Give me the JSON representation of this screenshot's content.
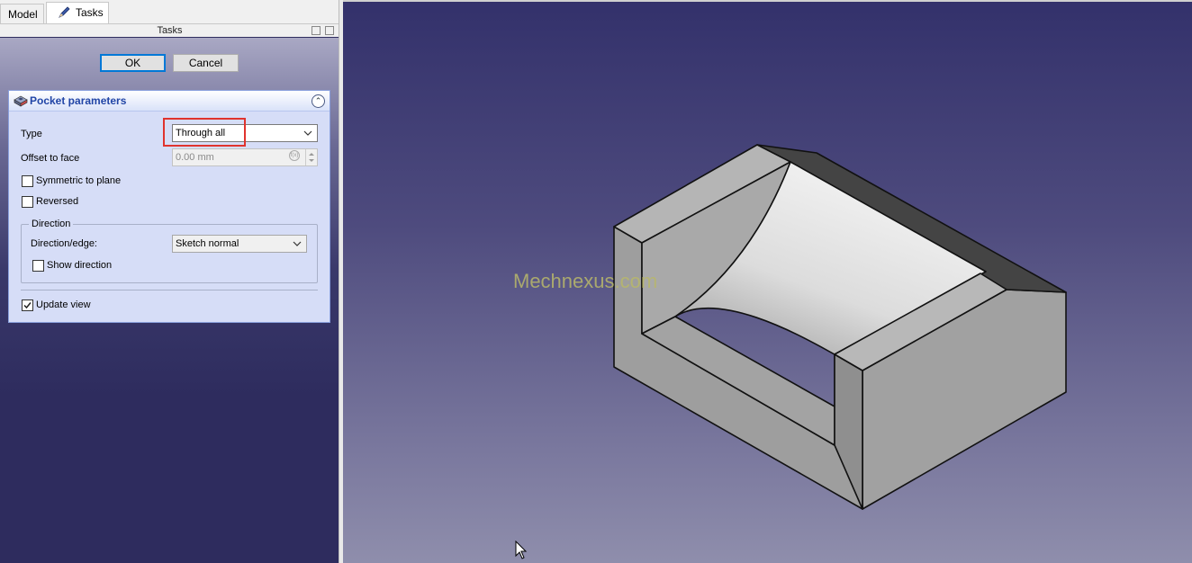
{
  "tabs": [
    {
      "label": "Model"
    },
    {
      "label": "Tasks"
    }
  ],
  "panel_title": "Tasks",
  "dialog": {
    "ok_label": "OK",
    "cancel_label": "Cancel"
  },
  "pocket": {
    "header": "Pocket parameters",
    "type_label": "Type",
    "type_value": "Through all",
    "offset_label": "Offset to face",
    "offset_value": "0.00 mm",
    "symmetric_label": "Symmetric to plane",
    "symmetric_checked": false,
    "reversed_label": "Reversed",
    "reversed_checked": false,
    "direction_group": "Direction",
    "direction_edge_label": "Direction/edge:",
    "direction_edge_value": "Sketch normal",
    "show_direction_label": "Show direction",
    "show_direction_checked": false,
    "update_view_label": "Update view",
    "update_view_checked": true
  },
  "viewport": {
    "watermark": "Mechnexus.com"
  },
  "colors": {
    "highlight": "#e0332e",
    "panel_header_text": "#2145a6",
    "focus_border": "#0078d7"
  }
}
